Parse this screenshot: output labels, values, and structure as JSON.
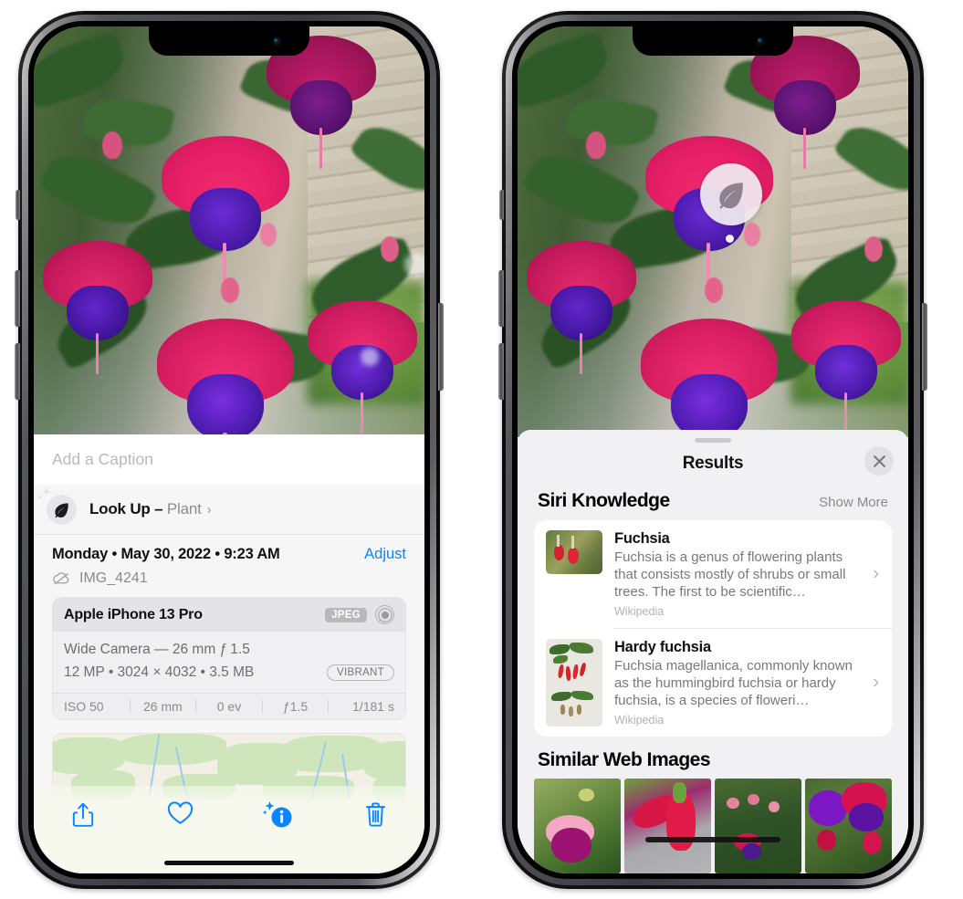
{
  "left_phone": {
    "name": "iphone-photos-info",
    "photo": {
      "alt": "fuchsia-flowers-photo"
    },
    "caption_field": {
      "placeholder": "Add a Caption",
      "value": ""
    },
    "lookup_row": {
      "icon": "leaf-icon",
      "sparkle_icon": "sparkles-icon",
      "label": "Look Up – ",
      "subject": "Plant",
      "chevron": "›"
    },
    "date_row": {
      "date_text": "Monday • May 30, 2022 • 9:23 AM",
      "adjust_label": "Adjust"
    },
    "file_row": {
      "icon": "cloud-slash-icon",
      "filename": "IMG_4241"
    },
    "exif": {
      "device": "Apple iPhone 13 Pro",
      "format_chip": "JPEG",
      "raw_icon": "aperture-icon",
      "lens_line": "Wide Camera — 26 mm ƒ 1.5",
      "size_line": "12 MP • 3024 × 4032 • 3.5 MB",
      "style_chip": "VIBRANT",
      "stats": [
        "ISO 50",
        "26 mm",
        "0 ev",
        "ƒ1.5",
        "1/181 s"
      ]
    },
    "map": {
      "name": "location-map-preview",
      "pin": "photo-thumbnail-pin"
    },
    "toolbar": [
      {
        "name": "share-button",
        "icon": "share-icon"
      },
      {
        "name": "favorite-button",
        "icon": "heart-icon"
      },
      {
        "name": "info-button",
        "icon": "info-sparkle-icon"
      },
      {
        "name": "delete-button",
        "icon": "trash-icon"
      }
    ],
    "accent_color": "#0a84ff"
  },
  "right_phone": {
    "name": "iphone-visual-lookup-results",
    "leaf_badge": {
      "icon": "leaf-icon"
    },
    "sheet": {
      "title": "Results",
      "close_icon": "close-x-icon",
      "grabber": "sheet-grabber"
    },
    "siri_knowledge": {
      "section_title": "Siri Knowledge",
      "show_more": "Show More",
      "items": [
        {
          "title": "Fuchsia",
          "description": "Fuchsia is a genus of flowering plants that consists mostly of shrubs or small trees. The first to be scientific…",
          "source": "Wikipedia",
          "thumb": "fuchsia-red-flowers-thumb",
          "chevron": "›"
        },
        {
          "title": "Hardy fuchsia",
          "description": "Fuchsia magellanica, commonly known as the hummingbird fuchsia or hardy fuchsia, is a species of floweri…",
          "source": "Wikipedia",
          "thumb": "hardy-fuchsia-specimen-thumb",
          "chevron": "›"
        }
      ]
    },
    "similar_web_images": {
      "section_title": "Similar Web Images",
      "items": [
        "web-image-pink-fuchsia",
        "web-image-red-fuchsia-closeup",
        "web-image-fuchsia-bush",
        "web-image-purple-fuchsia"
      ]
    }
  },
  "colors": {
    "ios_blue": "#0a84ff",
    "sheet_bg": "#f1f1f4",
    "card_bg": "#ffffff",
    "secondary_text": "#8a8a90"
  }
}
